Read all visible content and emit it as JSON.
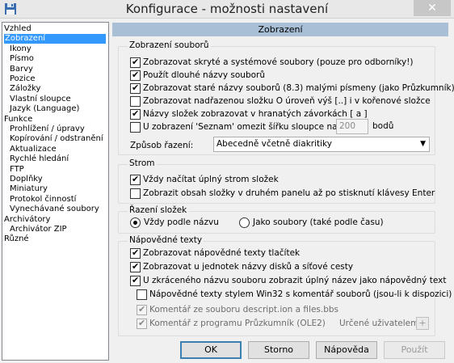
{
  "window": {
    "title": "Konfigurace - možnosti nastavení",
    "close_glyph": "✕"
  },
  "tree": {
    "items": [
      {
        "label": "Vzhled",
        "level": 0,
        "selected": false
      },
      {
        "label": "Zobrazení",
        "level": 0,
        "selected": true
      },
      {
        "label": "Ikony",
        "level": 1,
        "selected": false
      },
      {
        "label": "Písmo",
        "level": 1,
        "selected": false
      },
      {
        "label": "Barvy",
        "level": 1,
        "selected": false
      },
      {
        "label": "Pozice",
        "level": 1,
        "selected": false
      },
      {
        "label": "Záložky",
        "level": 1,
        "selected": false
      },
      {
        "label": "Vlastní sloupce",
        "level": 1,
        "selected": false
      },
      {
        "label": "Jazyk (Language)",
        "level": 1,
        "selected": false
      },
      {
        "label": "Funkce",
        "level": 0,
        "selected": false
      },
      {
        "label": "Prohlížení / úpravy",
        "level": 1,
        "selected": false
      },
      {
        "label": "Kopírování / odstranění",
        "level": 1,
        "selected": false
      },
      {
        "label": "Aktualizace",
        "level": 1,
        "selected": false
      },
      {
        "label": "Rychlé hledání",
        "level": 1,
        "selected": false
      },
      {
        "label": "FTP",
        "level": 1,
        "selected": false
      },
      {
        "label": "Doplňky",
        "level": 1,
        "selected": false
      },
      {
        "label": "Miniatury",
        "level": 1,
        "selected": false
      },
      {
        "label": "Protokol činností",
        "level": 1,
        "selected": false
      },
      {
        "label": "Vynechávané soubory",
        "level": 1,
        "selected": false
      },
      {
        "label": "Archivátory",
        "level": 0,
        "selected": false
      },
      {
        "label": "Archivátor ZIP",
        "level": 1,
        "selected": false
      },
      {
        "label": "Různé",
        "level": 0,
        "selected": false
      }
    ]
  },
  "page": {
    "header": "Zobrazení",
    "display_files": {
      "title": "Zobrazení souborů",
      "options": [
        {
          "label": "Zobrazovat skryté a systémové soubory (pouze pro odborníky!)",
          "checked": true
        },
        {
          "label": "Použít dlouhé názvy souborů",
          "checked": true
        },
        {
          "label": "Zobrazovat staré názvy souborů (8.3) malými písmeny (jako Průzkumník)",
          "checked": true
        },
        {
          "label": "Zobrazovat nadřazenou složku O úroveň výš [..] i v kořenové složce",
          "checked": false
        },
        {
          "label": "Názvy složek zobrazovat v hranatých závorkách [ a ]",
          "checked": true
        },
        {
          "label": "U zobrazení 'Seznam' omezit šířku sloupce na:",
          "checked": false
        }
      ],
      "column_width_value": "200",
      "column_width_unit": "bodů",
      "sort_label": "Způsob řazení:",
      "sort_value": "Abecedně včetně diakritiky"
    },
    "tree": {
      "title": "Strom",
      "options": [
        {
          "label": "Vždy načítat úplný strom složek",
          "checked": true
        },
        {
          "label": "Zobrazit obsah složky v druhém panelu až po stisknutí klávesy Enter",
          "checked": false
        }
      ]
    },
    "folder_sort": {
      "title": "Řazení složek",
      "radio1": "Vždy podle názvu",
      "radio2": "Jako soubory (také podle času)",
      "selected": 1
    },
    "tooltips": {
      "title": "Nápovědné texty",
      "options": [
        {
          "label": "Zobrazovat nápovědné texty tlačítek",
          "checked": true
        },
        {
          "label": "Zobrazovat u jednotek názvy disků a síťové cesty",
          "checked": true
        },
        {
          "label": "U zkráceného názvu souboru zobrazit úplný název jako nápovědný text",
          "checked": true
        },
        {
          "label": "Nápovědné texty stylem Win32 s komentář souborů (jsou-li k dispozici)",
          "checked": false
        }
      ],
      "sub_options": [
        {
          "label": "Komentář ze souboru descript.ion a files.bbs",
          "checked": true
        },
        {
          "label": "Komentář z programu Průzkumník (OLE2)",
          "checked": true
        }
      ],
      "user_defined_label": "Určené uživatelem:",
      "user_defined_button": "+"
    }
  },
  "buttons": {
    "ok": "OK",
    "cancel": "Storno",
    "help": "Nápověda",
    "apply": "Použít"
  },
  "colors": {
    "selection": "#3399ff",
    "header_bar": "#a8bfd6"
  }
}
